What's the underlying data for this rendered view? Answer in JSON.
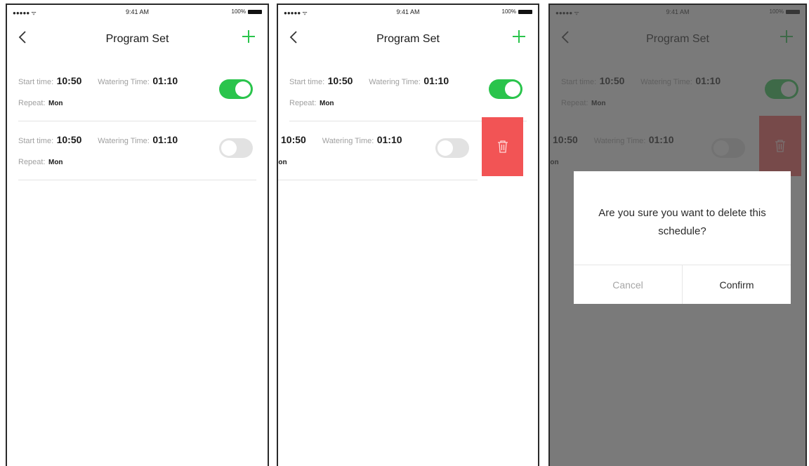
{
  "status_bar": {
    "clock": "9:41 AM",
    "battery": "100%"
  },
  "navbar": {
    "title": "Program Set"
  },
  "schedules": [
    {
      "start_label": "Start time:",
      "start_value": "10:50",
      "water_label": "Watering Time:",
      "water_value": "01:10",
      "repeat_label": "Repeat:",
      "repeat_value": "Mon",
      "enabled": true
    },
    {
      "start_label": "Start time:",
      "start_value": "10:50",
      "water_label": "Watering Time:",
      "water_value": "01:10",
      "repeat_label": "Repeat:",
      "repeat_value": "Mon",
      "enabled": false
    }
  ],
  "swiped_row": {
    "start_value": "10:50",
    "water_label": "Watering Time:",
    "water_value": "01:10",
    "repeat_value": "Mon"
  },
  "dialog": {
    "message": "Are you sure you want to delete this schedule?",
    "cancel_label": "Cancel",
    "confirm_label": "Confirm"
  },
  "colors": {
    "accent": "#2ac44c",
    "delete": "#f25455"
  },
  "icons": {
    "back": "chevron-left-icon",
    "add": "plus-icon",
    "delete": "trash-icon"
  }
}
